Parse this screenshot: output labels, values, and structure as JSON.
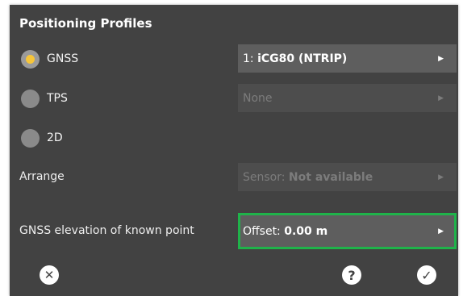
{
  "dialog": {
    "title": "Positioning Profiles"
  },
  "radios": [
    {
      "label": "GNSS",
      "selected": true
    },
    {
      "label": "TPS",
      "selected": false
    },
    {
      "label": "2D",
      "selected": false
    }
  ],
  "selects": {
    "gnss_profile": {
      "prefix": "1: ",
      "value": "iCG80 (NTRIP)"
    },
    "tps_profile": {
      "value": "None"
    },
    "arrange": {
      "label": "Arrange",
      "prefix": "Sensor: ",
      "value": "Not available"
    },
    "elevation": {
      "label": "GNSS elevation of known point",
      "prefix": "Offset: ",
      "value": "0.00 m"
    }
  },
  "arrow_glyph": "▶",
  "footer": {
    "close_glyph": "✕",
    "help_glyph": "?",
    "ok_glyph": "✓"
  },
  "colors": {
    "background": "#424242",
    "radio_selected_dot": "#f6c53a",
    "highlight_border": "#1fb34a"
  }
}
